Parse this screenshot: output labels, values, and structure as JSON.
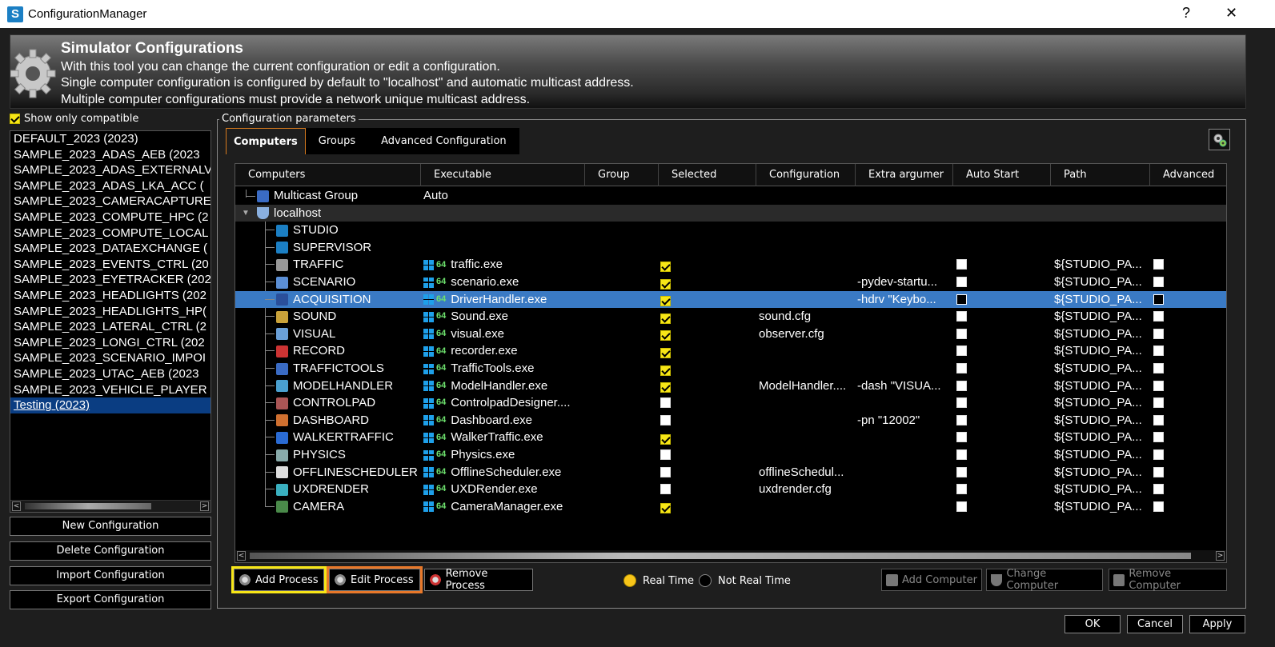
{
  "window": {
    "title": "ConfigurationManager",
    "help": "?",
    "close": "✕"
  },
  "header": {
    "title": "Simulator Configurations",
    "lines": [
      "With this tool you can change the current configuration or edit a configuration.",
      "Single computer configuration is configured by default to \"localhost\" and automatic multicast address.",
      "Multiple computer configurations must provide a network unique multicast address."
    ]
  },
  "left": {
    "show_compatible_label": "Show only compatible",
    "show_compatible_checked": true,
    "configs": [
      "DEFAULT_2023 (2023)",
      "SAMPLE_2023_ADAS_AEB (2023",
      "SAMPLE_2023_ADAS_EXTERNALV",
      "SAMPLE_2023_ADAS_LKA_ACC (",
      "SAMPLE_2023_CAMERACAPTURE",
      "SAMPLE_2023_COMPUTE_HPC (2",
      "SAMPLE_2023_COMPUTE_LOCAL",
      "SAMPLE_2023_DATAEXCHANGE (",
      "SAMPLE_2023_EVENTS_CTRL (20",
      "SAMPLE_2023_EYETRACKER (202",
      "SAMPLE_2023_HEADLIGHTS (202",
      "SAMPLE_2023_HEADLIGHTS_HP(",
      "SAMPLE_2023_LATERAL_CTRL (2",
      "SAMPLE_2023_LONGI_CTRL (202",
      "SAMPLE_2023_SCENARIO_IMPOI",
      "SAMPLE_2023_UTAC_AEB (2023",
      "SAMPLE_2023_VEHICLE_PLAYER",
      "Testing (2023)"
    ],
    "selected_index": 17,
    "buttons": {
      "new": "New Configuration",
      "delete": "Delete Configuration",
      "import": "Import Configuration",
      "export": "Export Configuration"
    }
  },
  "params": {
    "label": "Configuration parameters",
    "tabs": [
      "Computers",
      "Groups",
      "Advanced Configuration"
    ],
    "active_tab": 0,
    "columns": [
      "Computers",
      "Executable",
      "Group",
      "Selected",
      "Configuration",
      "Extra argumer",
      "Auto Start",
      "Path",
      "Advanced"
    ],
    "multicast": {
      "name": "Multicast Group",
      "value": "Auto"
    },
    "host": "localhost",
    "rows": [
      {
        "name": "STUDIO",
        "icon": "studio-icon",
        "exe": "",
        "selected": null,
        "config": "",
        "extra": "",
        "path": ""
      },
      {
        "name": "SUPERVISOR",
        "icon": "supervisor-icon",
        "exe": "",
        "selected": null,
        "config": "",
        "extra": "",
        "path": ""
      },
      {
        "name": "TRAFFIC",
        "icon": "traffic-icon",
        "exe": "traffic.exe",
        "selected": true,
        "config": "",
        "extra": "",
        "path": "${STUDIO_PA..."
      },
      {
        "name": "SCENARIO",
        "icon": "scenario-icon",
        "exe": "scenario.exe",
        "selected": true,
        "config": "",
        "extra": "-pydev-startu...",
        "path": "${STUDIO_PA..."
      },
      {
        "name": "ACQUISITION",
        "icon": "acquisition-icon",
        "exe": "DriverHandler.exe",
        "selected": true,
        "config": "",
        "extra": "-hdrv \"Keybo...",
        "path": "${STUDIO_PA..."
      },
      {
        "name": "SOUND",
        "icon": "sound-icon",
        "exe": "Sound.exe",
        "selected": true,
        "config": "sound.cfg",
        "extra": "",
        "path": "${STUDIO_PA..."
      },
      {
        "name": "VISUAL",
        "icon": "visual-icon",
        "exe": "visual.exe",
        "selected": true,
        "config": "observer.cfg",
        "extra": "",
        "path": "${STUDIO_PA..."
      },
      {
        "name": "RECORD",
        "icon": "record-icon",
        "exe": "recorder.exe",
        "selected": true,
        "config": "",
        "extra": "",
        "path": "${STUDIO_PA..."
      },
      {
        "name": "TRAFFICTOOLS",
        "icon": "traffictools-icon",
        "exe": "TrafficTools.exe",
        "selected": true,
        "config": "",
        "extra": "",
        "path": "${STUDIO_PA..."
      },
      {
        "name": "MODELHANDLER",
        "icon": "modelhandler-icon",
        "exe": "ModelHandler.exe",
        "selected": true,
        "config": "ModelHandler....",
        "extra": "-dash \"VISUA...",
        "path": "${STUDIO_PA..."
      },
      {
        "name": "CONTROLPAD",
        "icon": "controlpad-icon",
        "exe": "ControlpadDesigner....",
        "selected": false,
        "config": "",
        "extra": "",
        "path": "${STUDIO_PA..."
      },
      {
        "name": "DASHBOARD",
        "icon": "dashboard-icon",
        "exe": "Dashboard.exe",
        "selected": false,
        "config": "",
        "extra": "-pn \"12002\"",
        "path": "${STUDIO_PA..."
      },
      {
        "name": "WALKERTRAFFIC",
        "icon": "walker-icon",
        "exe": "WalkerTraffic.exe",
        "selected": true,
        "config": "",
        "extra": "",
        "path": "${STUDIO_PA..."
      },
      {
        "name": "PHYSICS",
        "icon": "physics-icon",
        "exe": "Physics.exe",
        "selected": false,
        "config": "",
        "extra": "",
        "path": "${STUDIO_PA..."
      },
      {
        "name": "OFFLINESCHEDULER",
        "icon": "scheduler-icon",
        "exe": "OfflineScheduler.exe",
        "selected": false,
        "config": "offlineSchedul...",
        "extra": "",
        "path": "${STUDIO_PA..."
      },
      {
        "name": "UXDRENDER",
        "icon": "uxdrender-icon",
        "exe": "UXDRender.exe",
        "selected": false,
        "config": "uxdrender.cfg",
        "extra": "",
        "path": "${STUDIO_PA..."
      },
      {
        "name": "CAMERA",
        "icon": "camera-icon",
        "exe": "CameraManager.exe",
        "selected": true,
        "config": "",
        "extra": "",
        "path": "${STUDIO_PA..."
      }
    ],
    "selected_row": 4,
    "badge64": "64",
    "buttons": {
      "add_process": "Add Process",
      "edit_process": "Edit Process",
      "remove_process": "Remove Process",
      "add_computer": "Add Computer",
      "change_computer": "Change Computer",
      "remove_computer": "Remove Computer"
    },
    "realtime": {
      "rt": "Real Time",
      "nrt": "Not Real Time",
      "selected": "rt"
    }
  },
  "footer": {
    "ok": "OK",
    "cancel": "Cancel",
    "apply": "Apply"
  },
  "colors": {
    "accent_orange": "#d67a1e",
    "check_yellow": "#f7e617",
    "selection_blue": "#3a7ac4",
    "highlight_yellow": "#f7e617",
    "highlight_orange": "#e8782a"
  }
}
